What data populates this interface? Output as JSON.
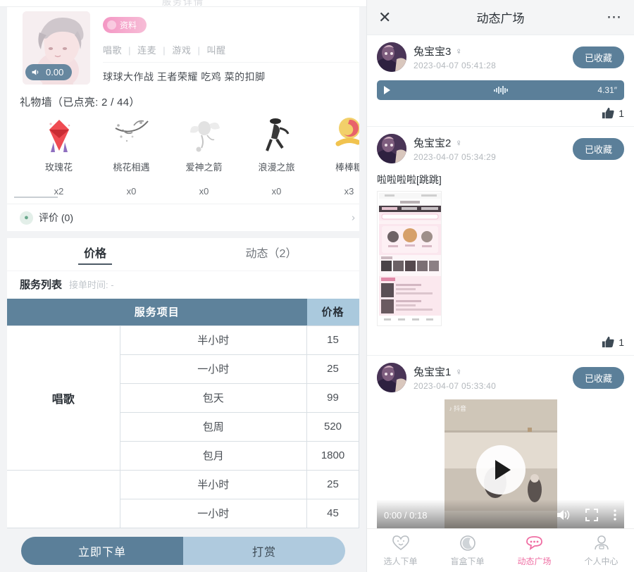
{
  "left": {
    "top_ghost_title": "服务详情",
    "profile": {
      "badge_label": "资料",
      "volume_value": "0.00",
      "volume_icon": "speaker-icon",
      "tags": [
        "唱歌",
        "连麦",
        "游戏",
        "叫醒"
      ],
      "description": "球球大作战 王者荣耀 吃鸡 菜的扣脚"
    },
    "gift_wall": {
      "title": "礼物墙（已点亮: 2 / 44）",
      "gifts": [
        {
          "name": "玫瑰花",
          "count": "x2",
          "icon": "rose-gift-icon"
        },
        {
          "name": "桃花相遇",
          "count": "x0",
          "icon": "peach-blossom-gift-icon"
        },
        {
          "name": "爱神之箭",
          "count": "x0",
          "icon": "cupid-arrow-gift-icon"
        },
        {
          "name": "浪漫之旅",
          "count": "x0",
          "icon": "romantic-trip-gift-icon"
        },
        {
          "name": "棒棒糖",
          "count": "x3",
          "icon": "lollipop-gift-icon"
        }
      ]
    },
    "review": {
      "label": "评价 (0)",
      "icon": "review-icon",
      "chevron": "›"
    },
    "tabs": [
      {
        "label": "价格",
        "active": true
      },
      {
        "label": "动态（2）",
        "active": false
      }
    ],
    "service": {
      "heading": "服务列表",
      "sub": "接单时间: -",
      "columns": [
        "服务项目",
        "价格"
      ],
      "category_col_header": "",
      "rows": [
        {
          "category": "唱歌",
          "span": 5,
          "item": "半小时",
          "price": "15"
        },
        {
          "category": "",
          "span": 0,
          "item": "一小时",
          "price": "25"
        },
        {
          "category": "",
          "span": 0,
          "item": "包天",
          "price": "99"
        },
        {
          "category": "",
          "span": 0,
          "item": "包周",
          "price": "520"
        },
        {
          "category": "",
          "span": 0,
          "item": "包月",
          "price": "1800"
        },
        {
          "category": "",
          "span": 2,
          "item": "半小时",
          "price": "25"
        },
        {
          "category": "",
          "span": 0,
          "item": "一小时",
          "price": "45"
        }
      ]
    },
    "actions": {
      "order_label": "立即下单",
      "tip_label": "打赏"
    }
  },
  "right": {
    "header": {
      "title": "动态广场",
      "close_icon": "close-icon",
      "more_icon": "more-dots-icon"
    },
    "posts": [
      {
        "name": "兔宝宝3",
        "gender_icon": "female-icon",
        "time": "2023-04-07 05:41:28",
        "fav_label": "已收藏",
        "text": "",
        "media": "audio",
        "audio": {
          "play_icon": "play-icon",
          "duration": "4.31″",
          "wave_icon": "waveform-icon"
        },
        "likes": "1",
        "like_icon": "thumbs-up-icon"
      },
      {
        "name": "兔宝宝2",
        "gender_icon": "female-icon",
        "time": "2023-04-07 05:34:29",
        "fav_label": "已收藏",
        "text": "啦啦啦啦[跳跳]",
        "media": "image",
        "likes": "1",
        "like_icon": "thumbs-up-icon"
      },
      {
        "name": "兔宝宝1",
        "gender_icon": "female-icon",
        "time": "2023-04-07 05:33:40",
        "fav_label": "已收藏",
        "text": "",
        "media": "video",
        "video": {
          "watermark": "抖音",
          "play_icon": "play-icon",
          "time_display": "0:00 / 0:18",
          "volume_icon": "volume-icon",
          "fullscreen_icon": "fullscreen-icon",
          "menu_icon": "kebab-menu-icon"
        },
        "likes": "",
        "like_icon": "thumbs-up-icon"
      }
    ],
    "tabbar": [
      {
        "label": "选人下单",
        "icon": "heart-face-icon",
        "active": false
      },
      {
        "label": "盲盒下单",
        "icon": "moon-icon",
        "active": false
      },
      {
        "label": "动态广场",
        "icon": "chat-bubble-icon",
        "active": true
      },
      {
        "label": "个人中心",
        "icon": "person-icon",
        "active": false
      }
    ]
  },
  "colors": {
    "steel": "#5b7f99",
    "light_blue": "#aac9dd",
    "pink_accent": "#ef6ea3",
    "table_header": "#5e829b"
  }
}
